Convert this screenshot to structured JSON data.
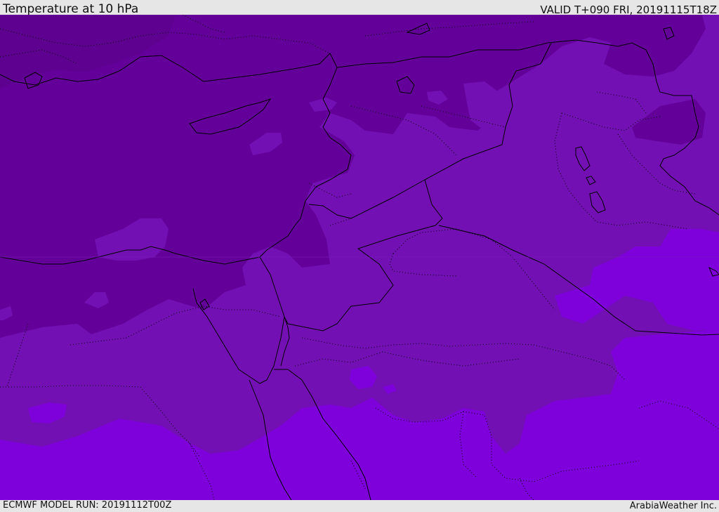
{
  "header": {
    "title": "Temperature at 10 hPa",
    "valid_time": "VALID T+090 FRI, 20191115T18Z"
  },
  "footer": {
    "model_run": "ECMWF MODEL RUN: 20191112T00Z",
    "credit": "ArabiaWeather Inc."
  },
  "colors": {
    "dark_shade": "#64009a",
    "mid_shade": "#7310b4",
    "light_shade": "#7e00da",
    "bright_patch": "#8000f0",
    "border_line": "#000000",
    "frame": "#e6e6e6"
  }
}
